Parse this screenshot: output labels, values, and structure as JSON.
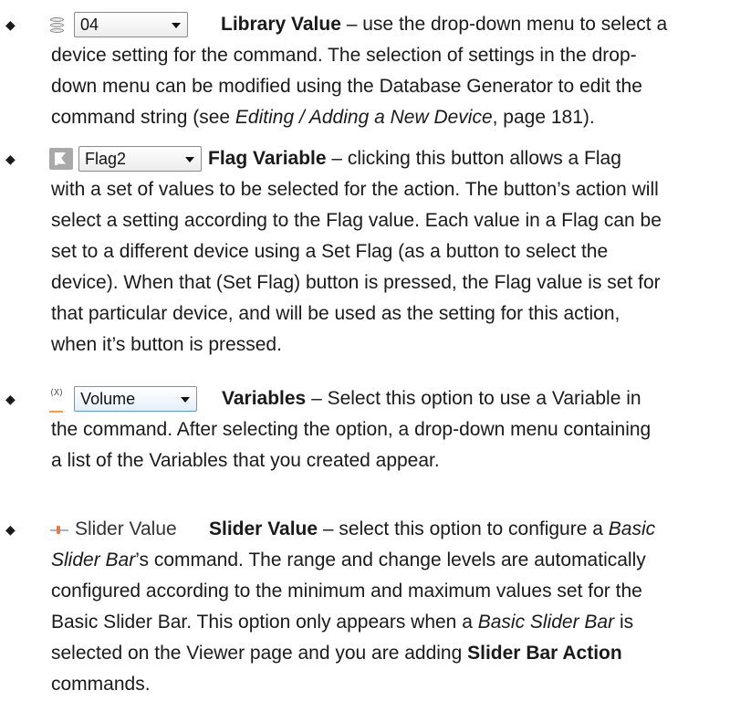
{
  "items": [
    {
      "control_value": "04",
      "icon": "database-icon",
      "lines": [
        {
          "parts": [
            {
              "t": "Library Value",
              "s": "b"
            },
            {
              "t": " – use the drop-down menu to select a"
            }
          ]
        },
        {
          "parts": [
            {
              "t": "device setting for the command. The selection of settings in the drop-"
            }
          ]
        },
        {
          "parts": [
            {
              "t": "down menu can be modified using the Database Generator to edit the"
            }
          ]
        },
        {
          "parts": [
            {
              "t": "command string (see "
            },
            {
              "t": "Editing / Adding a New Device",
              "s": "i"
            },
            {
              "t": ", page 181)."
            }
          ]
        }
      ]
    },
    {
      "control_value": "Flag2",
      "icon": "flag-icon",
      "lines": [
        {
          "parts": [
            {
              "t": "Flag Variable",
              "s": "b"
            },
            {
              "t": " – clicking this button allows a Flag"
            }
          ]
        },
        {
          "parts": [
            {
              "t": "with a set of values to be selected for the action. The button’s action will"
            }
          ]
        },
        {
          "parts": [
            {
              "t": "select a setting according to the Flag value. Each value in a Flag can be"
            }
          ]
        },
        {
          "parts": [
            {
              "t": "set to a different device using a Set Flag (as a button to select the"
            }
          ]
        },
        {
          "parts": [
            {
              "t": "device). When that (Set Flag) button is pressed, the Flag value is set for"
            }
          ]
        },
        {
          "parts": [
            {
              "t": "that particular device, and will be used as the setting for this action,"
            }
          ]
        },
        {
          "parts": [
            {
              "t": "when it’s button is pressed."
            }
          ]
        }
      ]
    },
    {
      "control_value": "Volume",
      "icon_text": "(X)",
      "icon": "variable-icon",
      "lines": [
        {
          "parts": [
            {
              "t": "Variables",
              "s": "b"
            },
            {
              "t": " – Select this option to use a Variable in"
            }
          ]
        },
        {
          "parts": [
            {
              "t": "the command. After selecting the option, a drop-down menu containing"
            }
          ]
        },
        {
          "parts": [
            {
              "t": "a list of the Variables that you created appear."
            }
          ]
        }
      ]
    },
    {
      "control_value": "Slider Value",
      "icon": "slider-icon",
      "lines": [
        {
          "parts": [
            {
              "t": "Slider Value",
              "s": "b"
            },
            {
              "t": " – select this option to configure a "
            },
            {
              "t": "Basic",
              "s": "i"
            }
          ]
        },
        {
          "parts": [
            {
              "t": "Slider Bar",
              "s": "i"
            },
            {
              "t": "’s command. The range and change levels are automatically"
            }
          ]
        },
        {
          "parts": [
            {
              "t": "configured according to the minimum and maximum values set for the"
            }
          ]
        },
        {
          "parts": [
            {
              "t": "Basic Slider Bar. This option only appears when a "
            },
            {
              "t": "Basic Slider Bar",
              "s": "i"
            },
            {
              "t": " is"
            }
          ]
        },
        {
          "parts": [
            {
              "t": "selected on the Viewer page and you are adding "
            },
            {
              "t": "Slider Bar Action",
              "s": "b"
            }
          ]
        },
        {
          "parts": [
            {
              "t": "commands."
            }
          ]
        }
      ]
    }
  ]
}
